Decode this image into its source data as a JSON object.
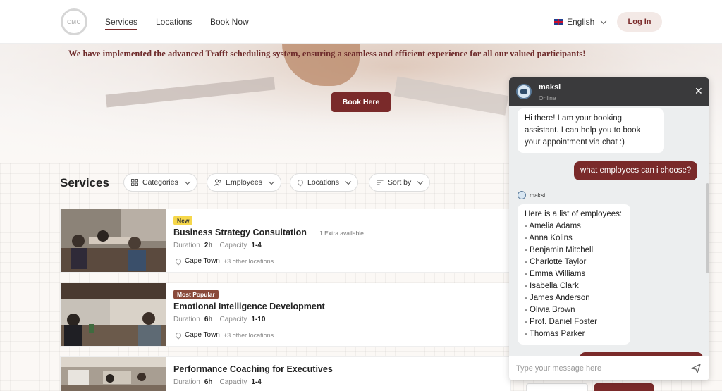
{
  "header": {
    "logo_text": "CMC",
    "nav": [
      "Services",
      "Locations",
      "Book Now"
    ],
    "language": "English",
    "login_label": "Log In"
  },
  "hero": {
    "message": "We have implemented the advanced Trafft scheduling system, ensuring a seamless and efficient experience for all our valued participants!",
    "button_label": "Book Here"
  },
  "services": {
    "title": "Services",
    "filters": [
      "Categories",
      "Employees",
      "Locations",
      "Sort by"
    ],
    "items": [
      {
        "badge": "New",
        "name": "Business Strategy Consultation",
        "extra": "1 Extra available",
        "duration_label": "Duration",
        "duration": "2h",
        "capacity_label": "Capacity",
        "capacity": "1-4",
        "location": "Cape Town",
        "other_locations": "+3 other locations"
      },
      {
        "badge": "Most Popular",
        "name": "Emotional Intelligence Development",
        "extra": "",
        "duration_label": "Duration",
        "duration": "6h",
        "capacity_label": "Capacity",
        "capacity": "1-10",
        "location": "Cape Town",
        "other_locations": "+3 other locations"
      },
      {
        "badge": "",
        "name": "Performance Coaching for Executives",
        "extra": "",
        "duration_label": "Duration",
        "duration": "6h",
        "capacity_label": "Capacity",
        "capacity": "1-4",
        "location": "",
        "other_locations": ""
      }
    ]
  },
  "chat": {
    "bot_name": "maksi",
    "status": "Online",
    "messages": [
      {
        "from": "bot",
        "text": "Hi there! I am your booking assistant. I can help you to book your appointment via chat :)"
      },
      {
        "from": "user",
        "text": "what employees can i choose?"
      },
      {
        "from": "bot",
        "sender": "maksi",
        "text": "Here is a list of employees:\n- Amelia Adams\n- Anna Kolins\n- Benjamin Mitchell\n- Charlotte Taylor\n- Emma Williams\n- Isabella Clark\n- James Anderson\n- Olivia Brown\n- Prof. Daniel Foster\n- Thomas Parker"
      }
    ],
    "input_placeholder": "Type your message here"
  },
  "colors": {
    "brand": "#7a2a2a",
    "badge_new": "#f6d74a",
    "badge_popular": "#8a4a3a",
    "chat_header": "#3a3a3c"
  }
}
